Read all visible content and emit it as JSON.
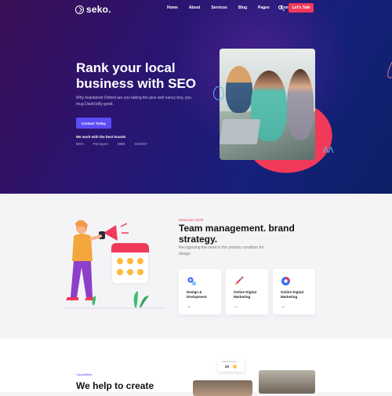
{
  "brand": {
    "name": "seko."
  },
  "nav": {
    "items": [
      "Home",
      "About",
      "Services",
      "Blog",
      "Pages",
      "Contact"
    ],
    "cta": "Let's Talk"
  },
  "hero": {
    "title": "Rank your local business with SEO",
    "subtitle": "Why knackered Oxford are you taking the piss well nancy boy, you mug David jolly good.",
    "button": "Contact Today",
    "brands_label": "We work with the best brands",
    "brands": [
      "BOX",
      "Ferrayon",
      "DBE",
      "GOODY"
    ]
  },
  "team": {
    "tag": "Extension 1979",
    "title": "Team management. brand strategy.",
    "description": "Recognizing the need is the primary condition for design",
    "cards": [
      {
        "label": "Design & Devlopment",
        "icon": "gears-icon",
        "arrow": "→"
      },
      {
        "label": "Online Digital Marketing",
        "icon": "rocket-icon",
        "arrow": "→"
      },
      {
        "label": "Online Digital Marketing",
        "icon": "pie-chart-icon",
        "arrow": "→"
      }
    ]
  },
  "capabilities": {
    "tag": "Capabilities",
    "title": "We help to create",
    "mini_card_label": "Default Schedule",
    "mini_card_value": "20"
  },
  "colors": {
    "accent": "#f1395a",
    "primary": "#5b4cf5",
    "hero_dark": "#16207a"
  }
}
